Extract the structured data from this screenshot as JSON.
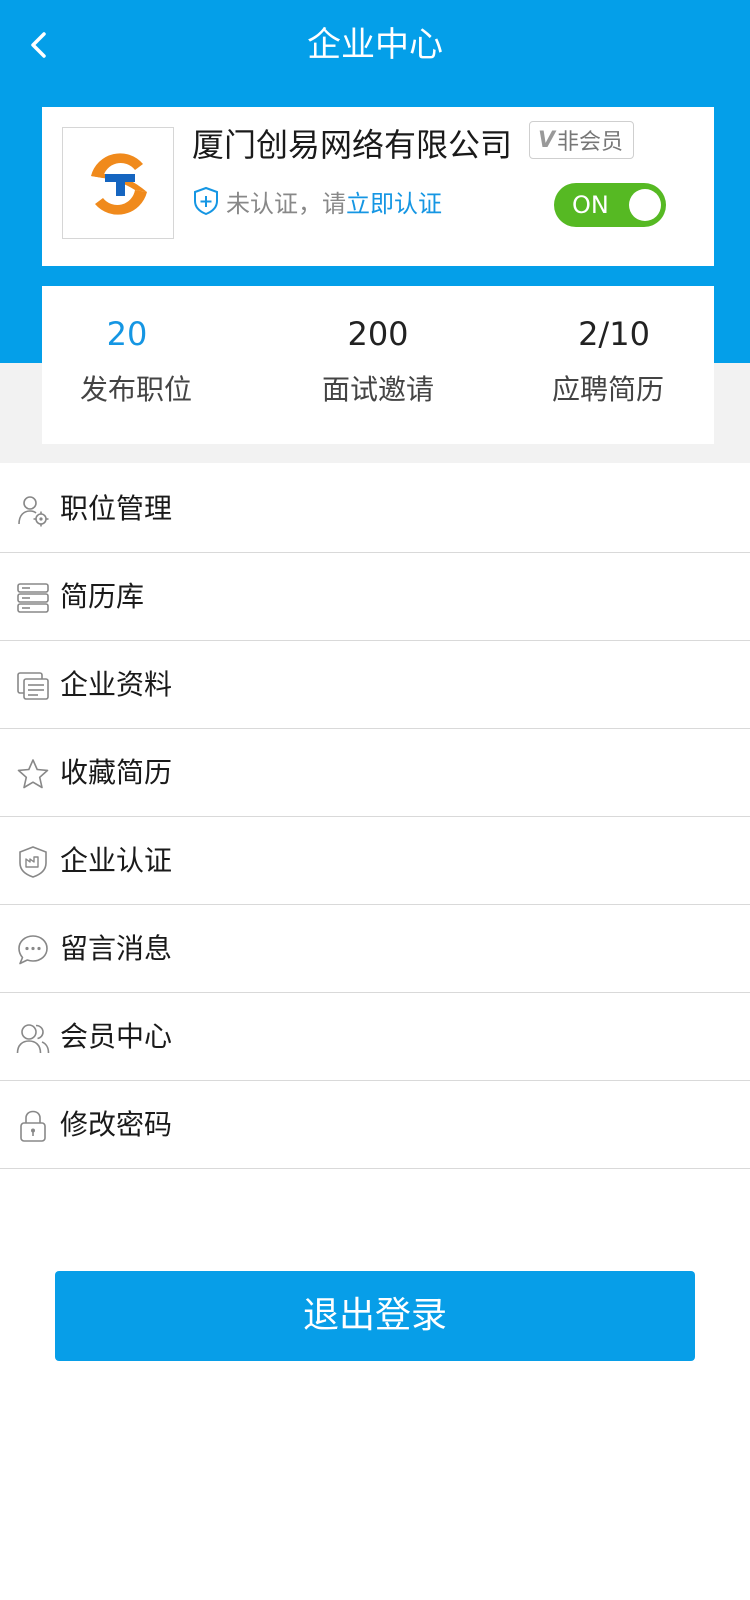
{
  "header": {
    "title": "企业中心",
    "background_color": "#049fe9"
  },
  "company": {
    "name": "厦门创易网络有限公司",
    "member_badge": "非会员",
    "member_badge_mark": "V",
    "cert_status": "未认证，请",
    "cert_link": "立即认证",
    "toggle_label": "ON",
    "toggle_on": true,
    "toggle_color": "#56b923"
  },
  "stats": [
    {
      "value": "20",
      "label": "发布职位",
      "highlight": true
    },
    {
      "value": "200",
      "label": "面试邀请",
      "highlight": false
    },
    {
      "value": "2/10",
      "label": "应聘简历",
      "highlight": false
    }
  ],
  "menu": [
    {
      "label": "职位管理",
      "icon": "user-gear-icon"
    },
    {
      "label": "简历库",
      "icon": "server-icon"
    },
    {
      "label": "企业资料",
      "icon": "cards-icon"
    },
    {
      "label": "收藏简历",
      "icon": "star-icon"
    },
    {
      "label": "企业认证",
      "icon": "shield-factory-icon"
    },
    {
      "label": "留言消息",
      "icon": "chat-bubble-icon"
    },
    {
      "label": "会员中心",
      "icon": "users-icon"
    },
    {
      "label": "修改密码",
      "icon": "lock-icon"
    }
  ],
  "logout_label": "退出登录",
  "colors": {
    "accent": "#1596e3",
    "logout_button": "#079ee8"
  }
}
